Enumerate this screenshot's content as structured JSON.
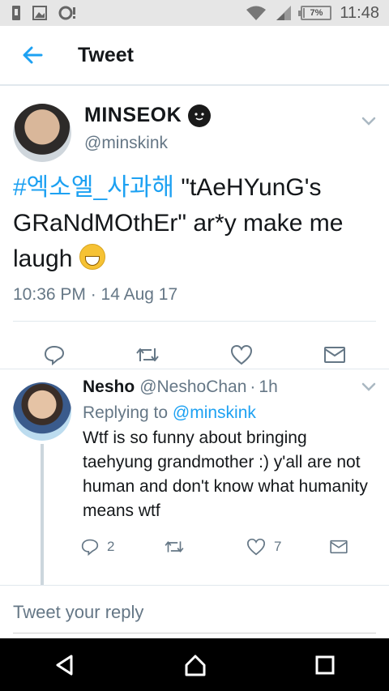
{
  "status_bar": {
    "time": "11:48",
    "battery_percent": "7%",
    "battery_level": 0.07
  },
  "app_bar": {
    "title": "Tweet"
  },
  "tweet": {
    "author_name": "MINSEOK",
    "handle": "@minskink",
    "hashtag": "#엑소엘_사과해",
    "text_line1_rest": " \"tAeHYunG's",
    "text_line2": "GRaNdMOthEr\" ar*y make me",
    "text_line3": "laugh ",
    "timestamp": "10:36 PM · 14 Aug 17",
    "colors": {
      "link": "#1da1f2",
      "muted": "#657786"
    }
  },
  "reply": {
    "name": "Nesho",
    "handle": "@NeshoChan",
    "dot": "·",
    "time": "1h",
    "replying_prefix": "Replying to ",
    "replying_handle": "@minskink",
    "text": "Wtf is so funny about bringing taehyung grandmother :) y'all are not human and don't know what humanity means wtf",
    "reply_count": "2",
    "retweet_count": "",
    "like_count": "7"
  },
  "composer": {
    "placeholder": "Tweet your reply"
  },
  "icons": [
    "sim-icon",
    "image-icon",
    "notification-icon",
    "wifi-icon",
    "signal-icon",
    "battery-icon",
    "back-arrow-icon",
    "emoji-face-icon",
    "chevron-down-icon",
    "reply-icon",
    "retweet-icon",
    "like-icon",
    "share-mail-icon",
    "nav-back-icon",
    "nav-home-icon",
    "nav-recents-icon"
  ]
}
